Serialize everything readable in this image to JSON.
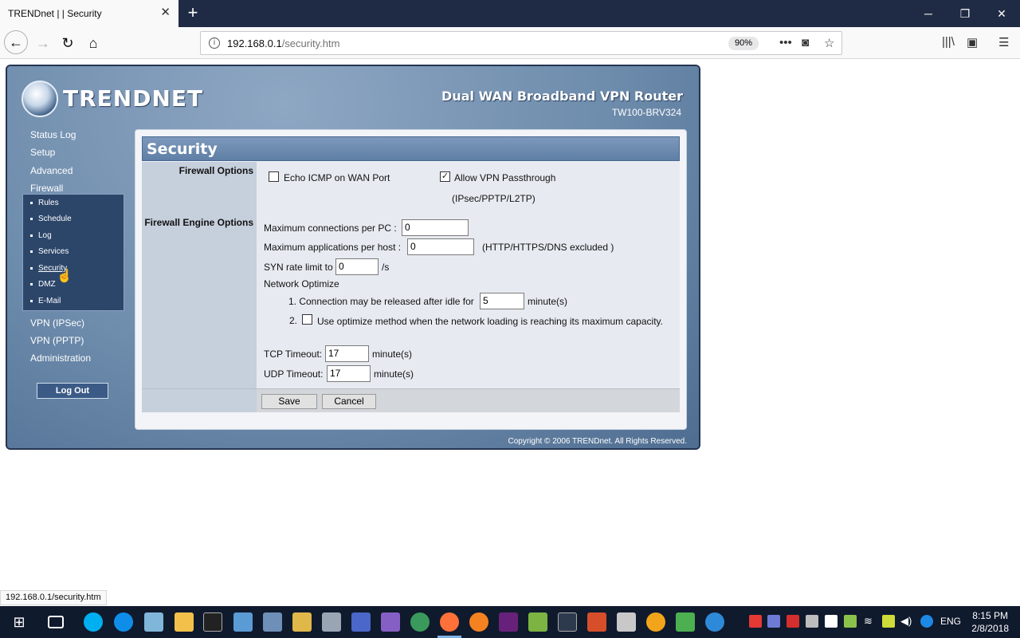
{
  "browser": {
    "tab_title": "TRENDnet | | Security",
    "url_host": "192.168.0.1",
    "url_path": "/security.htm",
    "zoom": "90%",
    "status_url": "192.168.0.1/security.htm"
  },
  "router": {
    "logo_text": "TRENDNET",
    "product_title": "Dual WAN Broadband VPN Router",
    "model": "TW100-BRV324",
    "copyright": "Copyright © 2006 TRENDnet. All Rights Reserved.",
    "logout_label": "Log Out"
  },
  "nav": {
    "items": [
      "Status Log",
      "Setup",
      "Advanced",
      "Firewall"
    ],
    "firewall_sub": [
      "Rules",
      "Schedule",
      "Log",
      "Services",
      "Security",
      "DMZ",
      "E-Mail"
    ],
    "active_sub": "Security",
    "items_after": [
      "VPN (IPSec)",
      "VPN (PPTP)",
      "Administration"
    ]
  },
  "panel": {
    "title": "Security",
    "firewall_options_label": "Firewall Options",
    "echo_icmp_label": "Echo ICMP on WAN Port",
    "echo_icmp_checked": false,
    "vpn_passthrough_label": "Allow VPN Passthrough",
    "vpn_passthrough_checked": true,
    "vpn_passthrough_note": "(IPsec/PPTP/L2TP)",
    "engine_options_label": "Firewall Engine Options",
    "max_conn_label": "Maximum connections per PC :",
    "max_conn_value": "0",
    "max_apps_label": "Maximum applications per host :",
    "max_apps_value": "0",
    "max_apps_note": "(HTTP/HTTPS/DNS excluded )",
    "syn_label": "SYN rate limit to",
    "syn_value": "0",
    "syn_unit": "/s",
    "net_optimize_label": "Network Optimize",
    "opt1_label": "1. Connection may be released after idle for",
    "opt1_value": "5",
    "opt1_unit": "minute(s)",
    "opt2_num": "2.",
    "opt2_label": "Use optimize method when the network loading is reaching its maximum capacity.",
    "opt2_checked": false,
    "tcp_label": "TCP Timeout:",
    "tcp_value": "17",
    "tcp_unit": "minute(s)",
    "udp_label": "UDP Timeout:",
    "udp_value": "17",
    "udp_unit": "minute(s)",
    "save_label": "Save",
    "cancel_label": "Cancel"
  },
  "taskbar": {
    "lang": "ENG",
    "time": "8:15 PM",
    "date": "2/8/2018"
  }
}
